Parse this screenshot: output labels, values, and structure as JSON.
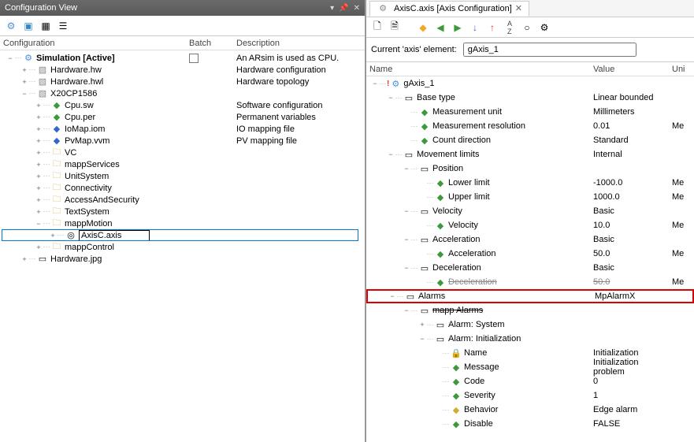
{
  "left": {
    "title": "Configuration View",
    "columns": {
      "c1": "Configuration",
      "c2": "Batch",
      "c3": "Description"
    },
    "rows": [
      {
        "depth": 0,
        "twisty": "−",
        "icon": "gear",
        "label": "Simulation [Active]",
        "bold": true,
        "batchBox": true,
        "desc": "An ARsim is used as CPU."
      },
      {
        "depth": 1,
        "twisty": "+",
        "icon": "cpu",
        "label": "Hardware.hw",
        "desc": "Hardware configuration"
      },
      {
        "depth": 1,
        "twisty": "+",
        "icon": "cpu",
        "label": "Hardware.hwl",
        "desc": "Hardware topology"
      },
      {
        "depth": 1,
        "twisty": "−",
        "icon": "cpu",
        "label": "X20CP1586",
        "desc": ""
      },
      {
        "depth": 2,
        "twisty": "+",
        "icon": "file-green",
        "label": "Cpu.sw",
        "desc": "Software configuration"
      },
      {
        "depth": 2,
        "twisty": "+",
        "icon": "file-green",
        "label": "Cpu.per",
        "desc": "Permanent variables"
      },
      {
        "depth": 2,
        "twisty": "+",
        "icon": "file-blue",
        "label": "IoMap.iom",
        "desc": "IO mapping file"
      },
      {
        "depth": 2,
        "twisty": "+",
        "icon": "file-blue",
        "label": "PvMap.vvm",
        "desc": "PV mapping file"
      },
      {
        "depth": 2,
        "twisty": "+",
        "icon": "folder",
        "label": "VC",
        "desc": ""
      },
      {
        "depth": 2,
        "twisty": "+",
        "icon": "folder",
        "label": "mappServices",
        "desc": ""
      },
      {
        "depth": 2,
        "twisty": "+",
        "icon": "folder",
        "label": "UnitSystem",
        "desc": ""
      },
      {
        "depth": 2,
        "twisty": "+",
        "icon": "folder",
        "label": "Connectivity",
        "desc": ""
      },
      {
        "depth": 2,
        "twisty": "+",
        "icon": "folder",
        "label": "AccessAndSecurity",
        "desc": ""
      },
      {
        "depth": 2,
        "twisty": "+",
        "icon": "folder",
        "label": "TextSystem",
        "desc": ""
      },
      {
        "depth": 2,
        "twisty": "−",
        "icon": "folder",
        "label": "mappMotion",
        "desc": ""
      },
      {
        "depth": 3,
        "twisty": "+",
        "icon": "axis",
        "label": "AxisC.axis",
        "edit": true,
        "selected": true,
        "desc": ""
      },
      {
        "depth": 2,
        "twisty": "+",
        "icon": "folder",
        "label": "mappControl",
        "desc": ""
      },
      {
        "depth": 1,
        "twisty": "+",
        "icon": "file-generic",
        "label": "Hardware.jpg",
        "desc": ""
      }
    ]
  },
  "right": {
    "tabLabel": "AxisC.axis [Axis Configuration]",
    "currentAxisLabel": "Current 'axis' element:",
    "currentAxisValue": "gAxis_1",
    "columns": {
      "name": "Name",
      "value": "Value",
      "unit": "Uni"
    },
    "rows": [
      {
        "depth": 0,
        "twisty": "−",
        "icon": "bang-cog",
        "label": "gAxis_1",
        "value": "",
        "unit": ""
      },
      {
        "depth": 1,
        "twisty": "−",
        "icon": "section",
        "label": "Base type",
        "value": "Linear bounded",
        "unit": ""
      },
      {
        "depth": 2,
        "twisty": "",
        "icon": "diamond-green",
        "label": "Measurement unit",
        "value": "Millimeters",
        "unit": ""
      },
      {
        "depth": 2,
        "twisty": "",
        "icon": "diamond-green",
        "label": "Measurement resolution",
        "value": "0.01",
        "unit": "Me"
      },
      {
        "depth": 2,
        "twisty": "",
        "icon": "diamond-green",
        "label": "Count direction",
        "value": "Standard",
        "unit": ""
      },
      {
        "depth": 1,
        "twisty": "−",
        "icon": "section",
        "label": "Movement limits",
        "value": "Internal",
        "unit": ""
      },
      {
        "depth": 2,
        "twisty": "−",
        "icon": "section",
        "label": "Position",
        "value": "",
        "unit": ""
      },
      {
        "depth": 3,
        "twisty": "",
        "icon": "diamond-green",
        "label": "Lower limit",
        "value": "-1000.0",
        "unit": "Me"
      },
      {
        "depth": 3,
        "twisty": "",
        "icon": "diamond-green",
        "label": "Upper limit",
        "value": "1000.0",
        "unit": "Me"
      },
      {
        "depth": 2,
        "twisty": "−",
        "icon": "section",
        "label": "Velocity",
        "value": "Basic",
        "unit": ""
      },
      {
        "depth": 3,
        "twisty": "",
        "icon": "diamond-green",
        "label": "Velocity",
        "value": "10.0",
        "unit": "Me"
      },
      {
        "depth": 2,
        "twisty": "−",
        "icon": "section",
        "label": "Acceleration",
        "value": "Basic",
        "unit": ""
      },
      {
        "depth": 3,
        "twisty": "",
        "icon": "diamond-green",
        "label": "Acceleration",
        "value": "50.0",
        "unit": "Me"
      },
      {
        "depth": 2,
        "twisty": "−",
        "icon": "section",
        "label": "Deceleration",
        "value": "Basic",
        "unit": ""
      },
      {
        "depth": 3,
        "twisty": "",
        "icon": "diamond-green",
        "label": "Deceleration",
        "value": "50.0",
        "unit": "Me",
        "strike": true
      },
      {
        "depth": 1,
        "twisty": "−",
        "icon": "section",
        "label": "Alarms",
        "value": "MpAlarmX",
        "unit": "",
        "highlight": true
      },
      {
        "depth": 2,
        "twisty": "−",
        "icon": "section",
        "label": "mapp Alarms",
        "value": "",
        "unit": "",
        "strikeTop": true
      },
      {
        "depth": 3,
        "twisty": "+",
        "icon": "section",
        "label": "Alarm: System",
        "value": "",
        "unit": ""
      },
      {
        "depth": 3,
        "twisty": "−",
        "icon": "section",
        "label": "Alarm: Initialization",
        "value": "",
        "unit": ""
      },
      {
        "depth": 4,
        "twisty": "",
        "icon": "lock-green",
        "label": "Name",
        "value": "Initialization",
        "unit": ""
      },
      {
        "depth": 4,
        "twisty": "",
        "icon": "diamond-green",
        "label": "Message",
        "value": "Initialization problem",
        "unit": ""
      },
      {
        "depth": 4,
        "twisty": "",
        "icon": "diamond-green",
        "label": "Code",
        "value": "0",
        "unit": ""
      },
      {
        "depth": 4,
        "twisty": "",
        "icon": "diamond-green",
        "label": "Severity",
        "value": "1",
        "unit": ""
      },
      {
        "depth": 4,
        "twisty": "",
        "icon": "diamond-yellow",
        "label": "Behavior",
        "value": "Edge alarm",
        "unit": ""
      },
      {
        "depth": 4,
        "twisty": "",
        "icon": "diamond-green",
        "label": "Disable",
        "value": "FALSE",
        "unit": ""
      }
    ]
  },
  "icons": {
    "gear": "⚙",
    "cpu": "▧",
    "file-green": "◆",
    "file-blue": "◆",
    "folder": "🗀",
    "axis": "◎",
    "file-generic": "▭",
    "diamond-green": "◆",
    "diamond-yellow": "◆",
    "section": "▭",
    "lock-green": "🔒",
    "bang-cog": "⚙"
  }
}
